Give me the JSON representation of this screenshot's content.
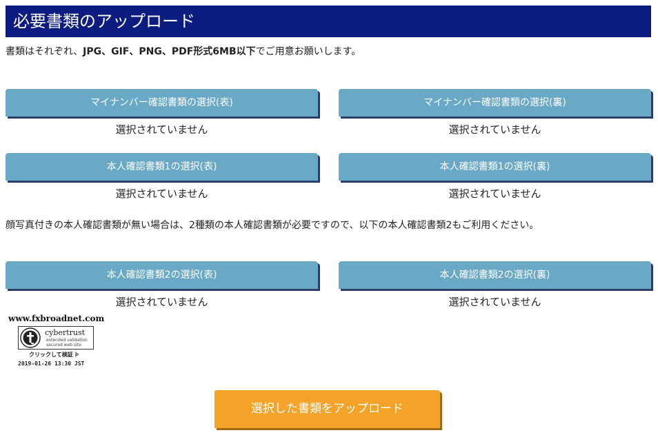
{
  "header": {
    "title": "必要書類のアップロード"
  },
  "intro": {
    "prefix": "書類はそれぞれ、",
    "formats": "JPG、GIF、PNG、PDF形式6MB以下",
    "suffix": "でご用意お願いします。"
  },
  "documents": {
    "mynumber_front": {
      "label": "マイナンバー確認書類の選択(表)",
      "status": "選択されていません"
    },
    "mynumber_back": {
      "label": "マイナンバー確認書類の選択(裏)",
      "status": "選択されていません"
    },
    "id1_front": {
      "label": "本人確認書類1の選択(表)",
      "status": "選択されていません"
    },
    "id1_back": {
      "label": "本人確認書類1の選択(裏)",
      "status": "選択されていません"
    },
    "id2_front": {
      "label": "本人確認書類2の選択(表)",
      "status": "選択されていません"
    },
    "id2_back": {
      "label": "本人確認書類2の選択(裏)",
      "status": "選択されていません"
    }
  },
  "note": "顔写真付きの本人確認書類が無い場合は、2種類の本人確認書類が必要ですので、以下の本人確認書類2もご利用ください。",
  "security_badge": {
    "site": "www.fxbroadnet.com",
    "brand": "cybertrust",
    "line1": "extended validation",
    "line2": "secured web site",
    "verify_label": "クリックして検証",
    "timestamp": "2019-01-26 13:30 JST"
  },
  "upload": {
    "label": "選択した書類をアップロード"
  },
  "colors": {
    "header_bg": "#0c1c80",
    "doc_button_bg": "#6aa9c6",
    "upload_button_bg": "#f5a328"
  }
}
